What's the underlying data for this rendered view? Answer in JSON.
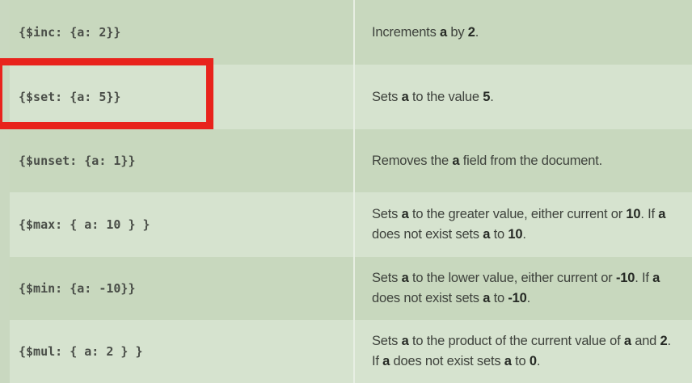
{
  "rows": [
    {
      "code": "{$inc: {a: 2}}",
      "desc": [
        {
          "t": "Increments "
        },
        {
          "t": "a",
          "b": true
        },
        {
          "t": " by "
        },
        {
          "t": "2",
          "b": true
        },
        {
          "t": "."
        }
      ]
    },
    {
      "code": "{$set: {a: 5}}",
      "desc": [
        {
          "t": "Sets "
        },
        {
          "t": "a",
          "b": true
        },
        {
          "t": " to the value "
        },
        {
          "t": "5",
          "b": true
        },
        {
          "t": "."
        }
      ]
    },
    {
      "code": "{$unset: {a: 1}}",
      "desc": [
        {
          "t": "Removes the "
        },
        {
          "t": "a",
          "b": true
        },
        {
          "t": " field from the document."
        }
      ]
    },
    {
      "code": "{$max: { a: 10 } }",
      "desc": [
        {
          "t": "Sets "
        },
        {
          "t": "a",
          "b": true
        },
        {
          "t": " to the greater value, either current or "
        },
        {
          "t": "10",
          "b": true
        },
        {
          "t": ". If "
        },
        {
          "t": "a",
          "b": true
        },
        {
          "t": " does not exist sets "
        },
        {
          "t": "a",
          "b": true
        },
        {
          "t": " to "
        },
        {
          "t": "10",
          "b": true
        },
        {
          "t": "."
        }
      ]
    },
    {
      "code": "{$min: {a: -10}}",
      "desc": [
        {
          "t": "Sets "
        },
        {
          "t": "a",
          "b": true
        },
        {
          "t": " to the lower value, either current or "
        },
        {
          "t": "-10",
          "b": true
        },
        {
          "t": ". If "
        },
        {
          "t": "a",
          "b": true
        },
        {
          "t": " does not exist sets "
        },
        {
          "t": "a",
          "b": true
        },
        {
          "t": " to "
        },
        {
          "t": "-10",
          "b": true
        },
        {
          "t": "."
        }
      ]
    },
    {
      "code": "{$mul: { a: 2 } }",
      "desc": [
        {
          "t": "Sets "
        },
        {
          "t": "a",
          "b": true
        },
        {
          "t": " to the product of the current value of "
        },
        {
          "t": "a",
          "b": true
        },
        {
          "t": " and "
        },
        {
          "t": "2",
          "b": true
        },
        {
          "t": ". If "
        },
        {
          "t": "a",
          "b": true
        },
        {
          "t": " does not exist sets "
        },
        {
          "t": "a",
          "b": true
        },
        {
          "t": " to "
        },
        {
          "t": "0",
          "b": true
        },
        {
          "t": "."
        }
      ]
    }
  ],
  "highlighted_row": 1,
  "colors": {
    "highlight": "#e8231c",
    "row_dark": "#c8d8be",
    "row_light": "#d6e3cf"
  }
}
